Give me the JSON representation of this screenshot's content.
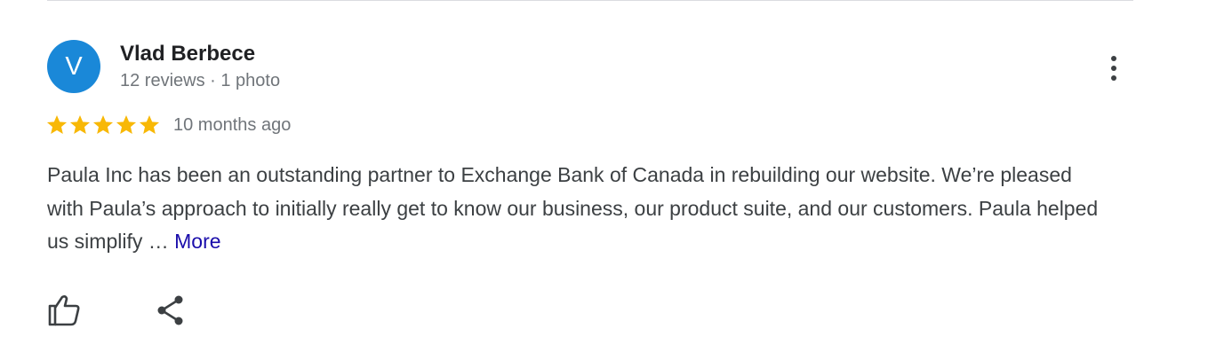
{
  "review": {
    "avatar_initial": "V",
    "avatar_color": "#1a88d8",
    "author_name": "Vlad Berbece",
    "author_meta": "12 reviews · 1 photo",
    "rating": 5,
    "rating_max": 5,
    "star_color": "#f8b806",
    "date": "10 months ago",
    "text": "Paula Inc has been an outstanding partner to Exchange Bank of Canada in rebuilding our website. We’re pleased with Paula’s approach to initially really get to know our business, our product suite, and our customers. Paula helped us simplify … ",
    "more_label": "More",
    "more_link_color": "#1a0dab"
  },
  "icons": {
    "menu": "more-vert-icon",
    "like": "thumbs-up-icon",
    "share": "share-icon"
  }
}
